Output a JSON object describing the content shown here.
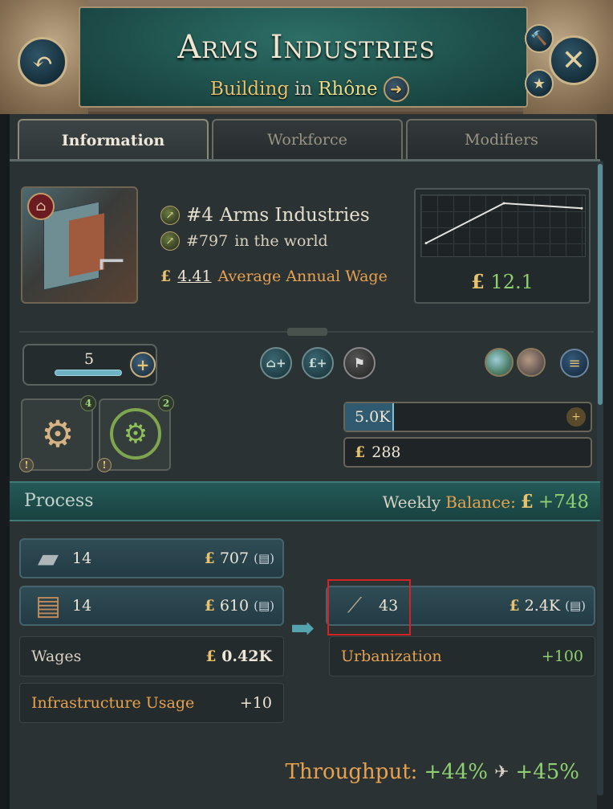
{
  "header": {
    "title": "Arms Industries",
    "subtitle_building": "Building",
    "subtitle_in": "in",
    "subtitle_place": "Rhône",
    "back_icon": "↶",
    "close_icon": "✕",
    "hammer_icon": "🔨",
    "star_icon": "★",
    "nav_icon": "➜"
  },
  "tabs": [
    {
      "label": "Information"
    },
    {
      "label": "Workforce"
    },
    {
      "label": "Modifiers"
    }
  ],
  "info": {
    "rank_number": "#4",
    "rank_name": "Arms Industries",
    "world_rank": "#797",
    "world_rank_suffix": "in the world",
    "wage_currency": "£",
    "wage_value": "4.41",
    "wage_label": "Average Annual Wage",
    "chart_currency": "£",
    "chart_value": "12.1"
  },
  "chart_data": {
    "type": "line",
    "x": [
      0,
      1,
      2
    ],
    "series": [
      {
        "values": [
          0.2,
          1.0,
          0.9
        ]
      }
    ]
  },
  "levels": {
    "value": "5",
    "plus": "+",
    "btn_home": "⌂+",
    "btn_money": "£+",
    "btn_flag": "⚑",
    "menu": "≡"
  },
  "production_methods": [
    {
      "icon": "⚙",
      "count": "4",
      "warn": "!"
    },
    {
      "icon": "⚙",
      "count": "2",
      "warn": "!"
    }
  ],
  "workforce": {
    "value": "5.0K",
    "fill_fraction": 0.2,
    "add_icon": "+"
  },
  "cash": {
    "currency": "£",
    "value": "288"
  },
  "process": {
    "title": "Process",
    "weekly": "Weekly",
    "balance": "Balance:",
    "currency": "£",
    "balance_value": "+748"
  },
  "inputs": [
    {
      "name": "Iron",
      "icon": "▰",
      "amount": "14",
      "currency": "£",
      "price": "707"
    },
    {
      "name": "Wood",
      "icon": "▤",
      "amount": "14",
      "currency": "£",
      "price": "610"
    }
  ],
  "output": {
    "icon": "⟋",
    "amount": "43",
    "currency": "£",
    "price": "2.4K"
  },
  "coin_icon": "(▤)",
  "wages": {
    "label": "Wages",
    "currency": "£",
    "value": "0.42K"
  },
  "infrastructure": {
    "label": "Infrastructure Usage",
    "value": "+10"
  },
  "urbanization": {
    "label": "Urbanization",
    "value": "+100"
  },
  "throughput": {
    "label": "Throughput:",
    "value1": "+44%",
    "plane": "✈",
    "value2": "+45%"
  },
  "arrow": "➡"
}
